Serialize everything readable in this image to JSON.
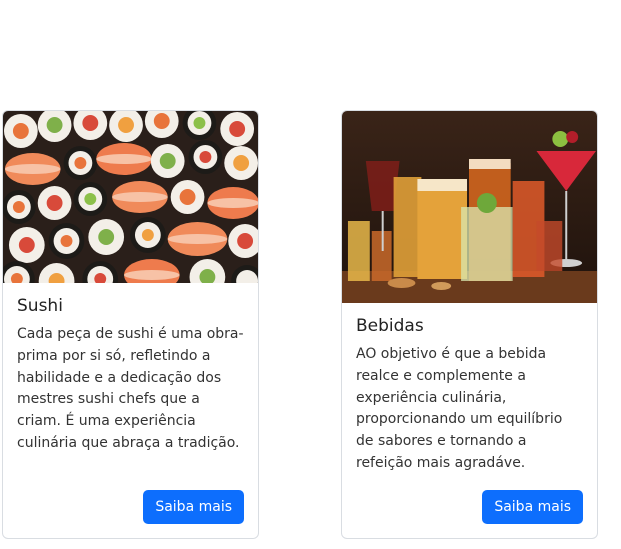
{
  "cards": [
    {
      "title": "Sushi",
      "description": "Cada peça de sushi é uma obra-prima por si só, refletindo a habilidade e a dedicação dos mestres sushi chefs que a criam. É uma experiência culinária que abraça a tradição.",
      "button_label": "Saiba mais",
      "image_subject": "sushi-platter"
    },
    {
      "title": "Bebidas",
      "description": "AO objetivo é que a bebida realce e complemente a experiência culinária, proporcionando um equilíbrio de sabores e tornando a refeição mais agradáve.",
      "button_label": "Saiba mais",
      "image_subject": "assorted-drinks"
    }
  ],
  "colors": {
    "button_bg": "#0d6efd",
    "card_border": "#d9dde2"
  }
}
